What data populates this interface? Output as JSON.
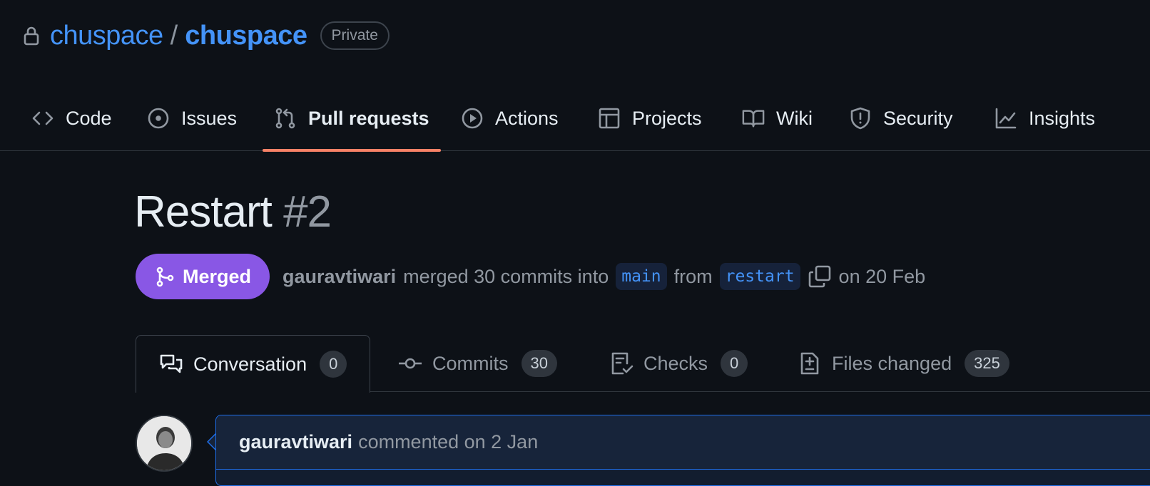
{
  "repo": {
    "owner": "chuspace",
    "separator": "/",
    "name": "chuspace",
    "visibility": "Private"
  },
  "nav": {
    "items": [
      {
        "label": "Code",
        "icon": "code-icon"
      },
      {
        "label": "Issues",
        "icon": "issue-icon"
      },
      {
        "label": "Pull requests",
        "icon": "pull-request-icon",
        "active": true
      },
      {
        "label": "Actions",
        "icon": "play-icon"
      },
      {
        "label": "Projects",
        "icon": "table-icon"
      },
      {
        "label": "Wiki",
        "icon": "book-icon"
      },
      {
        "label": "Security",
        "icon": "shield-icon"
      },
      {
        "label": "Insights",
        "icon": "graph-icon"
      }
    ]
  },
  "pr": {
    "title": "Restart",
    "number": "#2",
    "status": "Merged",
    "author": "gauravtiwari",
    "merged_text": "merged 30 commits into",
    "base_branch": "main",
    "from_text": "from",
    "head_branch": "restart",
    "date_text": "on 20 Feb"
  },
  "tabs": [
    {
      "label": "Conversation",
      "count": "0",
      "icon": "comment-discussion-icon",
      "active": true
    },
    {
      "label": "Commits",
      "count": "30",
      "icon": "commit-icon"
    },
    {
      "label": "Checks",
      "count": "0",
      "icon": "checklist-icon"
    },
    {
      "label": "Files changed",
      "count": "325",
      "icon": "file-diff-icon"
    }
  ],
  "comment": {
    "author": "gauravtiwari",
    "text": "commented on 2 Jan"
  },
  "colors": {
    "background": "#0d1117",
    "link": "#4493f8",
    "merged": "#8957e5",
    "active_tab_underline": "#f78166"
  }
}
